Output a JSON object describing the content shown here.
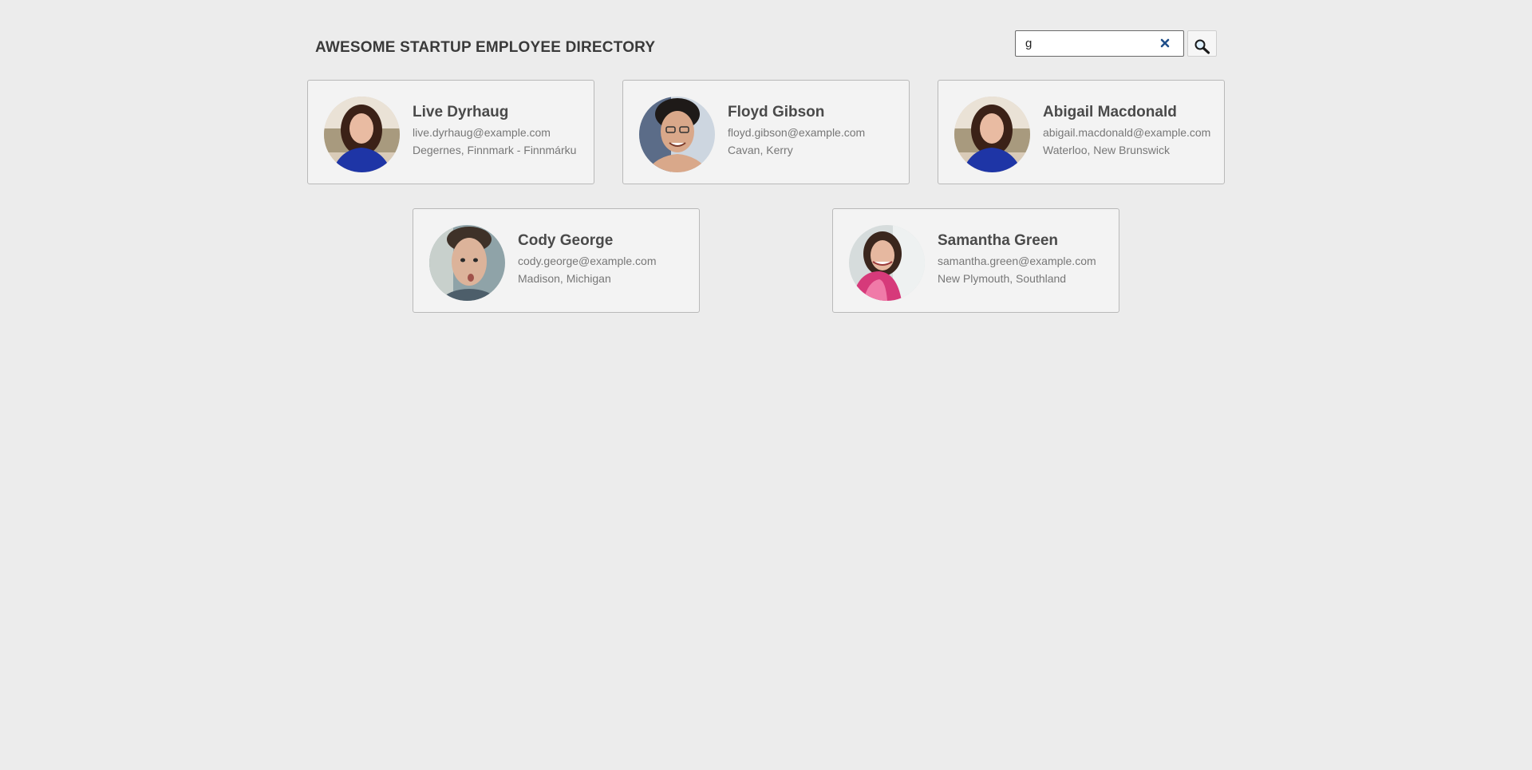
{
  "header": {
    "title": "AWESOME STARTUP EMPLOYEE DIRECTORY",
    "search": {
      "value": "g",
      "clear_icon": "close-icon",
      "button_icon": "search-icon"
    }
  },
  "employees": [
    {
      "name": "Live Dyrhaug",
      "email": "live.dyrhaug@example.com",
      "location": "Degernes, Finnmark - Finnmárku"
    },
    {
      "name": "Floyd Gibson",
      "email": "floyd.gibson@example.com",
      "location": "Cavan, Kerry"
    },
    {
      "name": "Abigail Macdonald",
      "email": "abigail.macdonald@example.com",
      "location": "Waterloo, New Brunswick"
    },
    {
      "name": "Cody George",
      "email": "cody.george@example.com",
      "location": "Madison, Michigan"
    },
    {
      "name": "Samantha Green",
      "email": "samantha.green@example.com",
      "location": "New Plymouth, Southland"
    }
  ],
  "colors": {
    "background": "#ececec",
    "card_background": "#f3f3f3",
    "card_border": "#b9b9b9",
    "clear_icon": "#1f4f8a"
  }
}
